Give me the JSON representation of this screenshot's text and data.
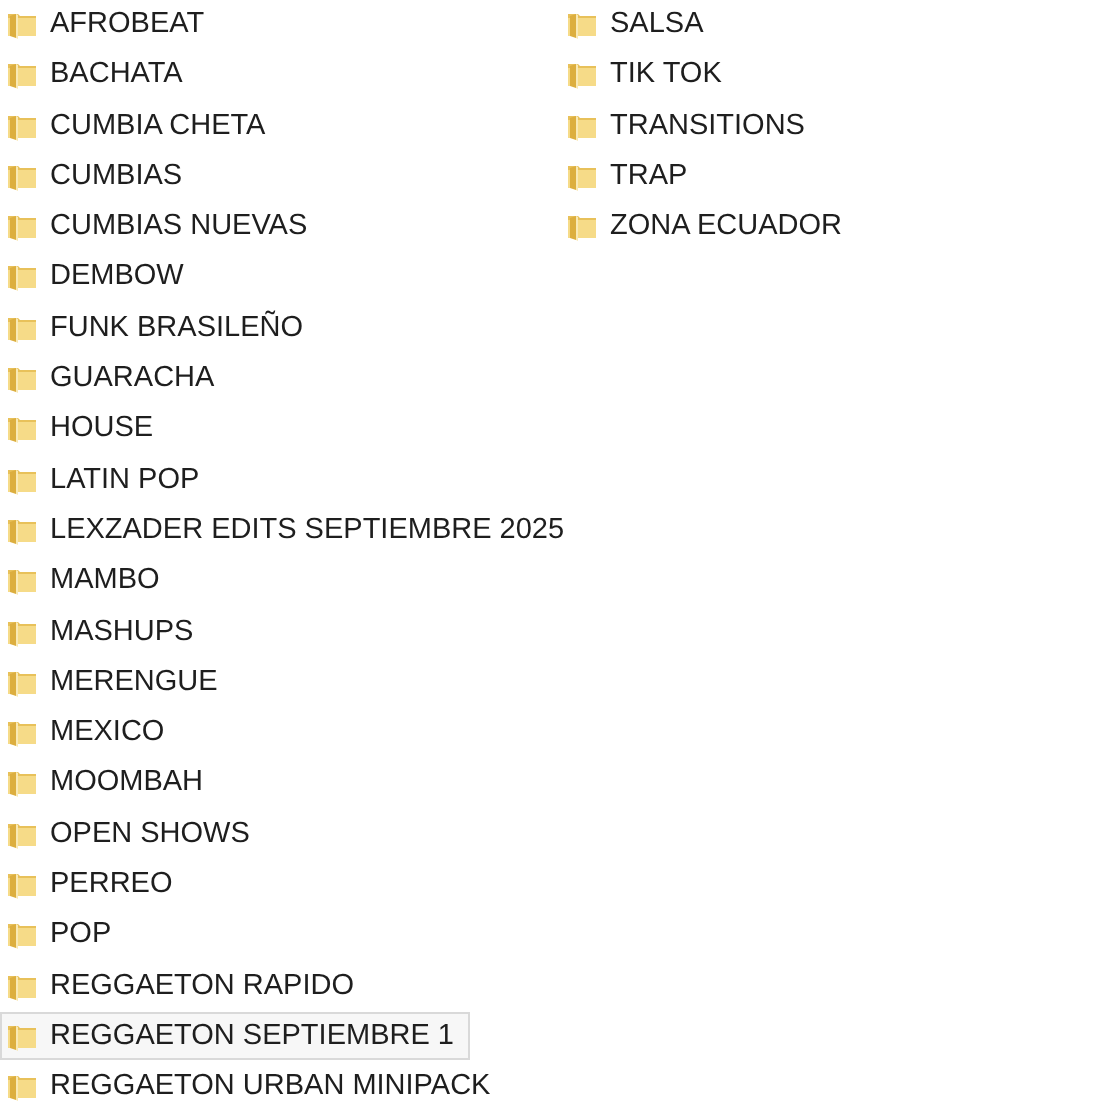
{
  "columns": [
    {
      "items": [
        {
          "name": "AFROBEAT",
          "selected": false
        },
        {
          "name": "BACHATA",
          "selected": false
        },
        {
          "name": "CUMBIA CHETA",
          "selected": false
        },
        {
          "name": "CUMBIAS",
          "selected": false
        },
        {
          "name": "CUMBIAS NUEVAS",
          "selected": false
        },
        {
          "name": "DEMBOW",
          "selected": false
        },
        {
          "name": "FUNK BRASILEÑO",
          "selected": false
        },
        {
          "name": "GUARACHA",
          "selected": false
        },
        {
          "name": "HOUSE",
          "selected": false
        },
        {
          "name": "LATIN POP",
          "selected": false
        },
        {
          "name": "LEXZADER EDITS SEPTIEMBRE 2025",
          "selected": false
        },
        {
          "name": "MAMBO",
          "selected": false
        },
        {
          "name": "MASHUPS",
          "selected": false
        },
        {
          "name": "MERENGUE",
          "selected": false
        },
        {
          "name": "MEXICO",
          "selected": false
        },
        {
          "name": "MOOMBAH",
          "selected": false
        },
        {
          "name": "OPEN SHOWS",
          "selected": false
        },
        {
          "name": "PERREO",
          "selected": false
        },
        {
          "name": "POP",
          "selected": false
        },
        {
          "name": "REGGAETON RAPIDO",
          "selected": false
        },
        {
          "name": "REGGAETON SEPTIEMBRE 1",
          "selected": true
        },
        {
          "name": "REGGAETON URBAN MINIPACK",
          "selected": false
        }
      ]
    },
    {
      "items": [
        {
          "name": "SALSA",
          "selected": false
        },
        {
          "name": "TIK TOK",
          "selected": false
        },
        {
          "name": "TRANSITIONS",
          "selected": false
        },
        {
          "name": "TRAP",
          "selected": false
        },
        {
          "name": "ZONA ECUADOR",
          "selected": false
        }
      ]
    }
  ]
}
